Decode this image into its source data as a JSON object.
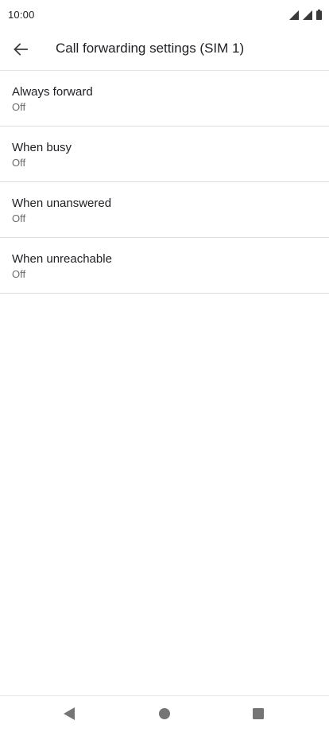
{
  "status_bar": {
    "time": "10:00",
    "icons": [
      "signal-icon",
      "signal-icon",
      "battery-icon"
    ]
  },
  "app_bar": {
    "back_icon": "arrow-back-icon",
    "title": "Call forwarding settings (SIM 1)"
  },
  "settings": {
    "items": [
      {
        "title": "Always forward",
        "summary": "Off"
      },
      {
        "title": "When busy",
        "summary": "Off"
      },
      {
        "title": "When unanswered",
        "summary": "Off"
      },
      {
        "title": "When unreachable",
        "summary": "Off"
      }
    ]
  },
  "nav_bar": {
    "buttons": [
      "back-triangle-icon",
      "home-circle-icon",
      "recents-square-icon"
    ]
  },
  "colors": {
    "text_primary": "#202124",
    "text_secondary": "#6b6b6b",
    "divider": "#dcdcdc",
    "icon_gray": "#757575"
  }
}
